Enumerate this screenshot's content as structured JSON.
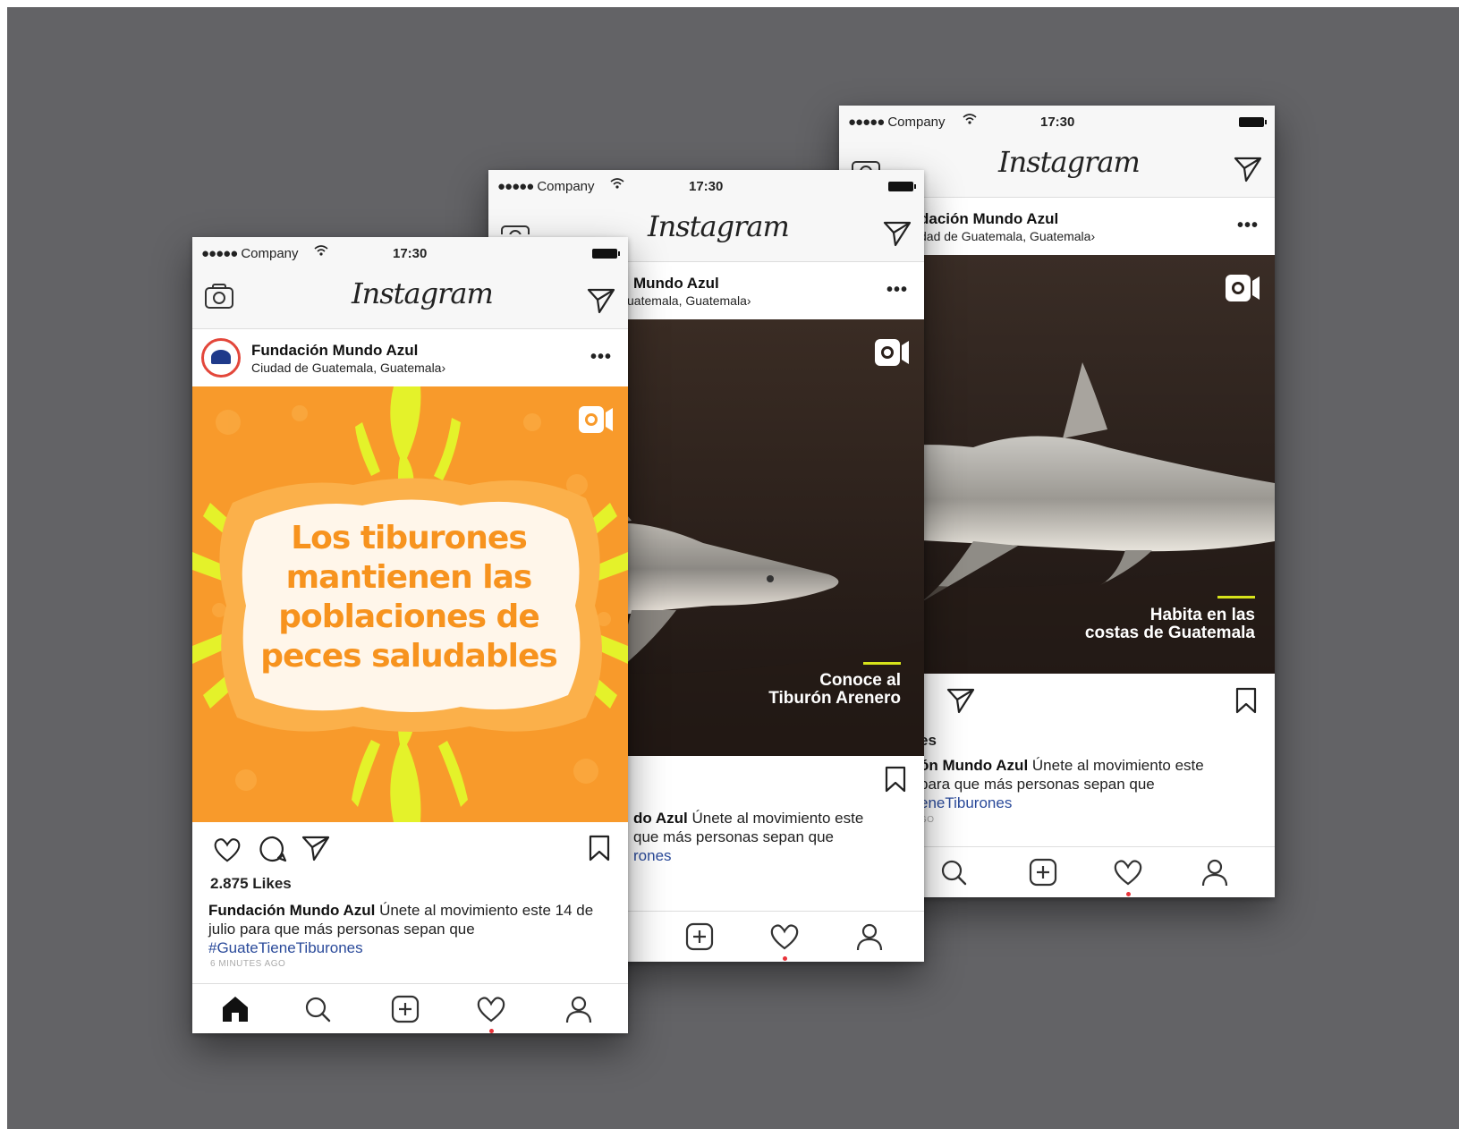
{
  "status": {
    "carrier": "Company",
    "signal_dots": "●●●●●",
    "time": "17:30"
  },
  "app": {
    "name": "Instagram"
  },
  "post": {
    "username": "Fundación Mundo Azul",
    "location": "Ciudad de Guatemala, Guatemala",
    "location_chevron": "›",
    "more": "•••",
    "likes": "2.875 Likes",
    "caption_user": "Fundación Mundo Azul",
    "caption_text": "Únete al movimiento este 14 de julio para que más personas sepan que",
    "hashtag": "#GuateTieneTiburones",
    "time_ago": "6 MINUTES AGO"
  },
  "phone1": {
    "artwork_lines": [
      "Los tiburones",
      "mantienen las",
      "poblaciones de",
      "peces saludables"
    ],
    "colors": {
      "orange": "#f89a2b",
      "light_orange": "#fbb04a",
      "yellow": "#e4f22a",
      "cream": "#fff6ea",
      "text": "#f7931e"
    }
  },
  "phone2": {
    "header_username": "Mundo Azul",
    "header_location": "uatemala, Guatemala",
    "overlay_line1": "Conoce al",
    "overlay_line2": "Tiburón Arenero",
    "caption_user": "do Azul",
    "caption_text1": "Únete al movimiento este",
    "caption_text2": "que más personas sepan que",
    "hashtag": "rones"
  },
  "phone3": {
    "header_username": "dación Mundo Azul",
    "header_location": "dad de Guatemala, Guatemala",
    "overlay_line1": "Habita en las",
    "overlay_line2": "costas de Guatemala",
    "likes_fragment": "es",
    "caption_user": "ón Mundo Azul",
    "caption_text1": "Únete al movimiento este",
    "caption_text2": "para que más personas sepan que",
    "hashtag": "eneTiburones",
    "ago_fragment": "GO"
  },
  "colors": {
    "background": "#636366",
    "accent_line": "#d7e31b",
    "notification": "#e8333a",
    "hashtag": "#2a4a9a",
    "shark_bg": "#2b211c"
  },
  "icons": [
    "camera-icon",
    "direct-message-icon",
    "igtv-icon",
    "heart-icon",
    "comment-icon",
    "share-icon",
    "bookmark-icon",
    "home-icon",
    "search-icon",
    "add-icon",
    "activity-icon",
    "profile-icon"
  ]
}
